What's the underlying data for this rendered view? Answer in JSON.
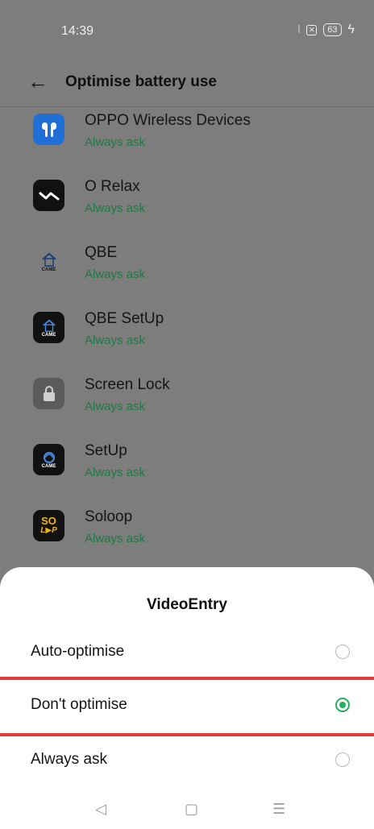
{
  "status_bar": {
    "time": "14:39",
    "battery": "63"
  },
  "header": {
    "title": "Optimise battery use"
  },
  "apps": [
    {
      "name": "OPPO Wireless Devices",
      "status": "Always ask",
      "icon": "earbuds-app-icon",
      "color": "#1f6fd6"
    },
    {
      "name": "O Relax",
      "status": "Always ask",
      "icon": "o-relax-app-icon",
      "color": "#111111"
    },
    {
      "name": "QBE",
      "status": "Always ask",
      "icon": "qbe-came-app-icon",
      "color": "#7d7d7d"
    },
    {
      "name": "QBE SetUp",
      "status": "Always ask",
      "icon": "qbe-setup-came-app-icon",
      "color": "#111111"
    },
    {
      "name": "Screen Lock",
      "status": "Always ask",
      "icon": "lock-app-icon",
      "color": "#5b5b5b"
    },
    {
      "name": "SetUp",
      "status": "Always ask",
      "icon": "setup-came-app-icon",
      "color": "#111111"
    },
    {
      "name": "Soloop",
      "status": "Always ask",
      "icon": "soloop-app-icon",
      "color": "#111111"
    }
  ],
  "icon_text": {
    "came": "CAME",
    "so": "SO",
    "loop": "L▶P"
  },
  "sheet": {
    "title": "VideoEntry",
    "options": [
      {
        "label": "Auto-optimise",
        "selected": false
      },
      {
        "label": "Don't optimise",
        "selected": true
      },
      {
        "label": "Always ask",
        "selected": false
      }
    ]
  },
  "colors": {
    "accent": "#22b05d",
    "status_text": "#1e7a45",
    "highlight": "#e33b3b"
  }
}
